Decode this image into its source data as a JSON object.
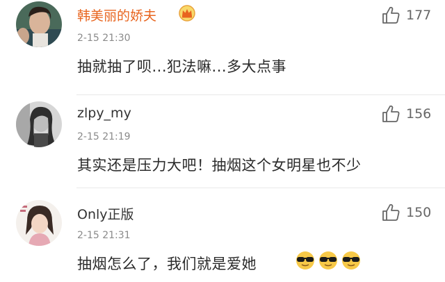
{
  "comments": [
    {
      "username": "韩美丽的娇夫",
      "badge_icon": "crown-icon",
      "timestamp": "2-15 21:30",
      "content": "抽就抽了呗...犯法嘛...多大点事",
      "likes": "177"
    },
    {
      "username": "zlpy_my",
      "timestamp": "2-15 21:19",
      "content": "其实还是压力大吧！抽烟这个女明星也不少",
      "likes": "156"
    },
    {
      "username": "Only正版",
      "timestamp": "2-15 21:31",
      "content": "抽烟怎么了，我们就是爱她",
      "emoji_icon": "sunglasses-emoji-icon",
      "likes": "150"
    }
  ],
  "colors": {
    "vip_name": "#e8651f",
    "name": "#333333",
    "meta": "#8a8a8a",
    "divider": "#e8e8e8"
  }
}
